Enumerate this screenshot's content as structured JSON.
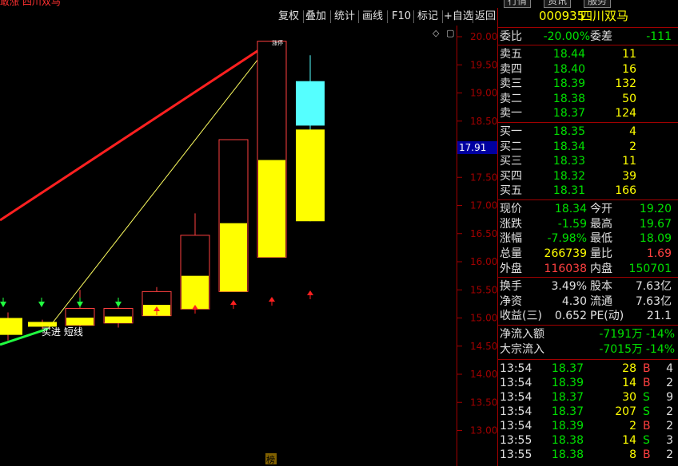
{
  "top": {
    "title": "敢涨 四川双马",
    "tabs": [
      "行情",
      "资讯",
      "服务"
    ]
  },
  "toolbar": {
    "items": [
      "复权",
      "叠加",
      "统计",
      "画线",
      "F10",
      "标记",
      "+自选",
      "返回"
    ]
  },
  "stock": {
    "code": "000935",
    "name": "四川双马"
  },
  "ratio": {
    "weibi_label": "委比",
    "weibi": "-20.00%",
    "weicha_label": "委差",
    "weicha": "-111"
  },
  "asks": [
    {
      "label": "卖五",
      "price": "18.44",
      "vol": "11"
    },
    {
      "label": "卖四",
      "price": "18.40",
      "vol": "16"
    },
    {
      "label": "卖三",
      "price": "18.39",
      "vol": "132"
    },
    {
      "label": "卖二",
      "price": "18.38",
      "vol": "50"
    },
    {
      "label": "卖一",
      "price": "18.37",
      "vol": "124"
    }
  ],
  "bids": [
    {
      "label": "买一",
      "price": "18.35",
      "vol": "4"
    },
    {
      "label": "买二",
      "price": "18.34",
      "vol": "2"
    },
    {
      "label": "买三",
      "price": "18.33",
      "vol": "11"
    },
    {
      "label": "买四",
      "price": "18.32",
      "vol": "39"
    },
    {
      "label": "买五",
      "price": "18.31",
      "vol": "166"
    }
  ],
  "quote": [
    {
      "l1": "现价",
      "v1": "18.34",
      "c1": "dn",
      "l2": "今开",
      "v2": "19.20",
      "c2": "dn"
    },
    {
      "l1": "涨跌",
      "v1": "-1.59",
      "c1": "dn",
      "l2": "最高",
      "v2": "19.67",
      "c2": "dn"
    },
    {
      "l1": "涨幅",
      "v1": "-7.98%",
      "c1": "dn",
      "l2": "最低",
      "v2": "18.09",
      "c2": "dn"
    },
    {
      "l1": "总量",
      "v1": "266739",
      "c1": "yl",
      "l2": "量比",
      "v2": "1.69",
      "c2": "up"
    },
    {
      "l1": "外盘",
      "v1": "116038",
      "c1": "up",
      "l2": "内盘",
      "v2": "150701",
      "c2": "dn"
    }
  ],
  "fund": [
    {
      "l1": "换手",
      "v1": "3.49%",
      "l2": "股本",
      "v2": "7.63亿"
    },
    {
      "l1": "净资",
      "v1": "4.30",
      "l2": "流通",
      "v2": "7.63亿"
    },
    {
      "l1": "收益(三)",
      "v1": "0.652",
      "l2": "PE(动)",
      "v2": "21.1"
    }
  ],
  "flow": [
    {
      "label": "净流入额",
      "val": "-7191万",
      "pct": "-14%"
    },
    {
      "label": "大宗流入",
      "val": "-7015万",
      "pct": "-14%"
    }
  ],
  "ticks": [
    {
      "time": "13:54",
      "price": "18.37",
      "vol": "28",
      "bs": "B",
      "n": "4"
    },
    {
      "time": "13:54",
      "price": "18.39",
      "vol": "14",
      "bs": "B",
      "n": "2"
    },
    {
      "time": "13:54",
      "price": "18.37",
      "vol": "30",
      "bs": "S",
      "n": "9"
    },
    {
      "time": "13:54",
      "price": "18.37",
      "vol": "207",
      "bs": "S",
      "n": "2"
    },
    {
      "time": "13:54",
      "price": "18.39",
      "vol": "2",
      "bs": "B",
      "n": "2"
    },
    {
      "time": "13:55",
      "price": "18.38",
      "vol": "14",
      "bs": "S",
      "n": "3"
    },
    {
      "time": "13:55",
      "price": "18.38",
      "vol": "8",
      "bs": "B",
      "n": "2"
    }
  ],
  "chart_data": {
    "type": "candlestick",
    "y_ticks": [
      "20.00",
      "19.50",
      "19.00",
      "18.50",
      "18.00",
      "17.50",
      "17.00",
      "16.50",
      "16.00",
      "15.50",
      "15.00",
      "14.50",
      "14.00",
      "13.50",
      "13.00"
    ],
    "ylim": [
      12.7,
      20.2
    ],
    "current_price": "17.91",
    "candles": [
      {
        "open": 15.0,
        "close": 14.7,
        "high": 15.1,
        "low": 14.6,
        "fill": "yellow"
      },
      {
        "open": 14.93,
        "close": 14.85,
        "high": 14.97,
        "low": 14.8,
        "fill": "yellow"
      },
      {
        "open": 14.87,
        "close": 15.17,
        "high": 15.5,
        "low": 14.85,
        "fill": "red-outline"
      },
      {
        "open": 14.91,
        "close": 15.17,
        "high": 15.21,
        "low": 14.83,
        "fill": "red-outline"
      },
      {
        "open": 15.04,
        "close": 15.47,
        "high": 15.55,
        "low": 15.04,
        "fill": "red-outline"
      },
      {
        "open": 15.16,
        "close": 16.47,
        "high": 16.86,
        "low": 15.11,
        "fill": "red-outline"
      },
      {
        "open": 15.47,
        "close": 18.17,
        "high": 18.17,
        "low": 15.47,
        "fill": "red-outline"
      },
      {
        "open": 16.08,
        "close": 19.92,
        "high": 19.92,
        "low": 16.08,
        "fill": "red-outline"
      },
      {
        "open": 16.72,
        "close": 19.21,
        "high": 19.67,
        "low": 16.72,
        "fill": "cyan"
      }
    ],
    "annotations": [
      "买进 短线",
      "涨停",
      "榜"
    ],
    "signals": {
      "down_arrows": [
        0,
        1,
        2,
        3
      ],
      "up_arrows": [
        4,
        5,
        6,
        7,
        8
      ]
    }
  },
  "colors": {
    "up": "#ff4040",
    "down": "#00e000",
    "grid": "#a00000",
    "yellow": "#ffff00",
    "cyan": "#55ffff"
  }
}
